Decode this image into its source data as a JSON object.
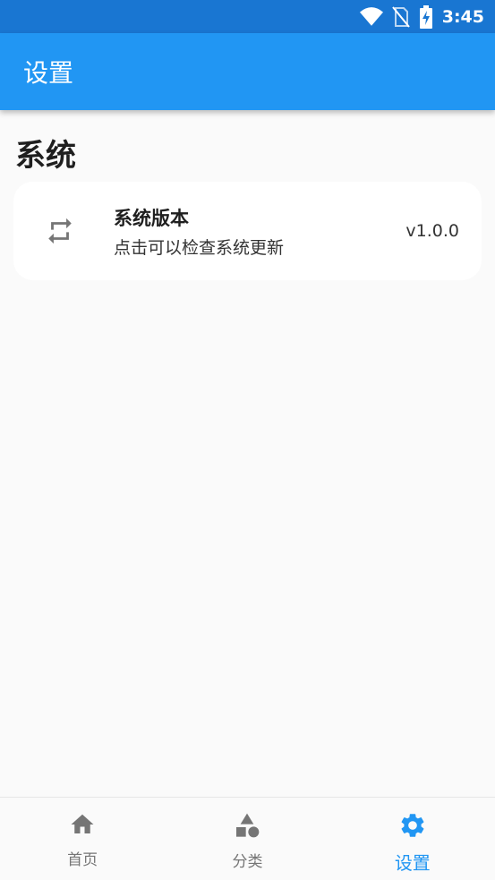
{
  "status_bar": {
    "time": "3:45",
    "icons": [
      "wifi-icon",
      "no-sim-icon",
      "battery-charging-icon"
    ]
  },
  "app_bar": {
    "title": "设置"
  },
  "section": {
    "title": "系统",
    "items": [
      {
        "icon": "repeat-icon",
        "title": "系统版本",
        "subtitle": "点击可以检查系统更新",
        "value": "v1.0.0"
      }
    ]
  },
  "bottom_nav": {
    "items": [
      {
        "icon": "home-icon",
        "label": "首页",
        "active": false
      },
      {
        "icon": "category-icon",
        "label": "分类",
        "active": false
      },
      {
        "icon": "settings-icon",
        "label": "设置",
        "active": true
      }
    ]
  },
  "colors": {
    "primary": "#2196f3",
    "status_bar": "#1976d2",
    "inactive": "#757575",
    "background": "#fafafa"
  }
}
